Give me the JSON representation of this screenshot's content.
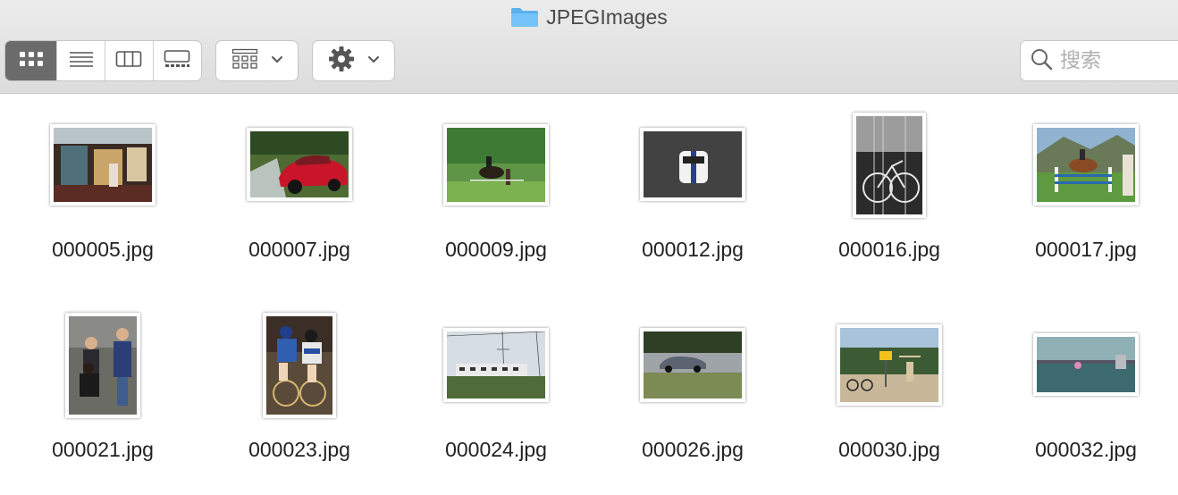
{
  "window": {
    "title": "JPEGImages",
    "title_icon": "folder-icon"
  },
  "toolbar": {
    "view_modes": [
      {
        "name": "icon-view",
        "icon": "grid-icon",
        "active": true
      },
      {
        "name": "list-view",
        "icon": "list-icon",
        "active": false
      },
      {
        "name": "column-view",
        "icon": "columns-icon",
        "active": false
      },
      {
        "name": "gallery-view",
        "icon": "gallery-icon",
        "active": false
      }
    ],
    "group_button_icon": "group-grid-icon",
    "action_button_icon": "gear-icon"
  },
  "search": {
    "placeholder": "搜索",
    "value": ""
  },
  "files": [
    {
      "name": "000005.jpg",
      "scene": "interior"
    },
    {
      "name": "000007.jpg",
      "scene": "red car"
    },
    {
      "name": "000009.jpg",
      "scene": "horse on grass"
    },
    {
      "name": "000012.jpg",
      "scene": "white car"
    },
    {
      "name": "000016.jpg",
      "scene": "bicycle"
    },
    {
      "name": "000017.jpg",
      "scene": "show jumping"
    },
    {
      "name": "000021.jpg",
      "scene": "people"
    },
    {
      "name": "000023.jpg",
      "scene": "cyclists"
    },
    {
      "name": "000024.jpg",
      "scene": "train"
    },
    {
      "name": "000026.jpg",
      "scene": "car on road"
    },
    {
      "name": "000030.jpg",
      "scene": "cyclists with sign"
    },
    {
      "name": "000032.jpg",
      "scene": "airport"
    }
  ]
}
